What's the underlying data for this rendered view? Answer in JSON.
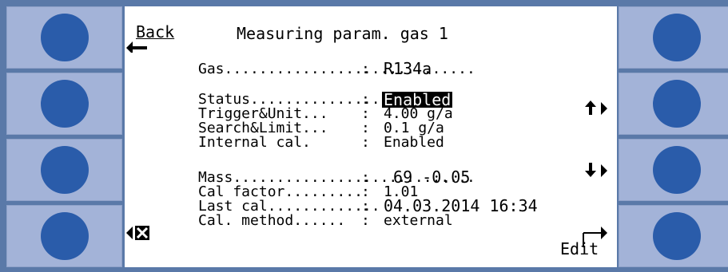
{
  "screen": {
    "back_label": "Back",
    "title": "Measuring param. gas 1",
    "edit_label": "Edit",
    "params": [
      {
        "label": "Gas.............................",
        "value": "R134a"
      },
      {
        "label": "Status...................",
        "value": "Enabled"
      },
      {
        "label": "Trigger&Unit...",
        "value": "4.00 g/a"
      },
      {
        "label": "Search&Limit...",
        "value": "0.1 g/a"
      },
      {
        "label": "Internal cal.",
        "value": "Enabled"
      },
      {
        "label": "Mass............................",
        "value": " 69 -0.05"
      },
      {
        "label": "Cal factor.........",
        "value": "1.01"
      },
      {
        "label": "Last cal.............",
        "value": "04.03.2014 16:34"
      },
      {
        "label": "Cal. method......",
        "value": "external"
      }
    ],
    "separator": ":"
  },
  "colors": {
    "bezel": "#5a79a8",
    "button_face": "#a3b3d8",
    "knob": "#2a5caa"
  },
  "icons": [
    "back-arrow-icon",
    "close-icon",
    "arrow-up-icon",
    "arrow-down-icon",
    "edit-arrow-icon"
  ]
}
